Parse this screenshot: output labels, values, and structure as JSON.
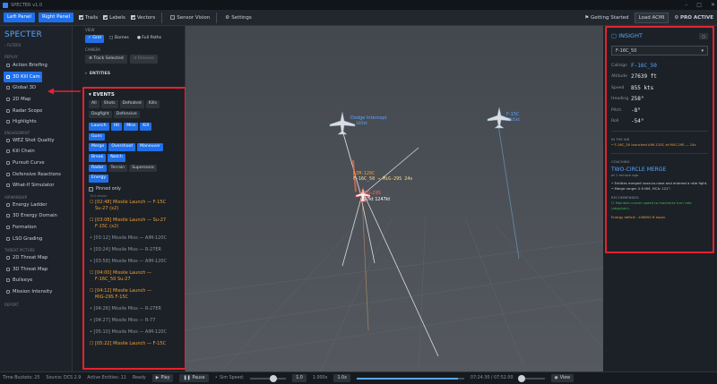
{
  "titlebar": {
    "title": "SPECTER v1.0"
  },
  "toolbar": {
    "left_panel": "Left Panel",
    "right_panel": "Right Panel",
    "trails": "Trails",
    "labels": "Labels",
    "vectors": "Vectors",
    "sensor_vision": "Sensor Vision",
    "settings": "Settings",
    "getting_started": "Getting Started",
    "load_acmi": "Load ACMI",
    "pro_active": "PRO ACTIVE"
  },
  "sidebar": {
    "brand": "SPECTER",
    "filters": "FILTERS",
    "replay_label": "REPLAY",
    "replay": [
      "Action Briefing",
      "3D Kill Cam",
      "Global 3D",
      "2D Map",
      "Radar Scope",
      "Highlights"
    ],
    "engagement_label": "ENGAGEMENT",
    "engagement": [
      "WEZ Shot Quality",
      "Kill Chain",
      "Pursuit Curve",
      "Defensive Reactions",
      "What-If Simulator"
    ],
    "airmanship_label": "AIRMANSHIP",
    "airmanship": [
      "Energy Ladder",
      "3D Energy Domain",
      "Formation",
      "LSO Grading"
    ],
    "threat_label": "THREAT PICTURE",
    "threat": [
      "2D Threat Map",
      "3D Threat Map",
      "Bullseye",
      "Mission Intensity"
    ],
    "report_label": "REPORT"
  },
  "panel": {
    "view_label": "VIEW",
    "grid": "Grid",
    "domes": "Domes",
    "full_paths": "Full Paths",
    "camera_label": "CAMERA",
    "track_selected": "Track Selected",
    "release": "Release",
    "entities": "ENTITIES",
    "events": "EVENTS",
    "chips_row1": [
      "All",
      "Shots",
      "Defeated",
      "Kills"
    ],
    "chips_row2": [
      "Dogfight",
      "Defensive"
    ],
    "chips_row3": [
      "Launch",
      "Hit",
      "Miss",
      "Kill"
    ],
    "chips_row4": [
      "Guns"
    ],
    "chips_row5": [
      "Merge",
      "Overshoot",
      "Maneuver"
    ],
    "chips_row6": [
      "Break",
      "Notch"
    ],
    "chips_row7": [
      "Radar",
      "Terrain",
      "Supersonic"
    ],
    "chips_row8": [
      "Energy"
    ],
    "pinned": "Pinned only",
    "shown": "154 shown",
    "events_list": [
      {
        "t": "[02:48] Missile Launch — F-15C",
        "t2": "Su-27 (x2)",
        "kind": "launch"
      },
      {
        "t": "[03:08] Missile Launch — Su-27",
        "t2": "F-15C (x2)",
        "kind": "launch"
      },
      {
        "t": "[03:12] Missile Miss — AIM-120C",
        "t2": "",
        "kind": "miss"
      },
      {
        "t": "[03:24] Missile Miss — R-27ER",
        "t2": "",
        "kind": "miss"
      },
      {
        "t": "[03:58] Missile Miss — AIM-120C",
        "t2": "",
        "kind": "miss"
      },
      {
        "t": "[04:00] Missile Launch —",
        "t2": "F-16C_50 Su-27",
        "kind": "launch"
      },
      {
        "t": "[04:12] Missile Launch —",
        "t2": "MiG-29S F-15C",
        "kind": "launch"
      },
      {
        "t": "[04:26] Missile Miss — R-27ER",
        "t2": "",
        "kind": "miss"
      },
      {
        "t": "[04:27] Missile Miss — R-77",
        "t2": "",
        "kind": "miss"
      },
      {
        "t": "[05:10] Missile Miss — AIM-120C",
        "t2": "",
        "kind": "miss"
      },
      {
        "t": "[05:22] Missile Launch — F-15C",
        "t2": "",
        "kind": "launch"
      }
    ]
  },
  "viewport": {
    "label_a": "Dodge Intercept",
    "label_a2": "305kt",
    "label_b": "F-15C",
    "label_b2": "305kt",
    "aim_label": "AIM-120C",
    "f16_label": "F-16C_50 → MiG-29S  24s",
    "mig_label": "MiG-29S",
    "mig_speed": "247kt   1247kt"
  },
  "insight": {
    "title": "INSIGHT",
    "select": "F-16C_50",
    "callsign_k": "Callsign",
    "callsign_v": "F-16C_50",
    "altitude_k": "Altitude",
    "altitude_v": "27639 ft",
    "speed_k": "Speed",
    "speed_v": "855 kts",
    "heading_k": "Heading",
    "heading_v": "258°",
    "pitch_k": "Pitch",
    "pitch_v": "-8°",
    "roll_k": "Roll",
    "roll_v": "-54°",
    "inair_label": "IN THE AIR",
    "inair_text": "• F-16C_50 launched AIM-120C at MiG-29S — 24s",
    "coach_label": "COACHING",
    "coach_title": "TWO-CIRCLE MERGE",
    "coach_sub": "at 1 minute ago",
    "coach_b1": "• Entities merged nose-to-nose and entered a rate fight.",
    "coach_b2": "• Merge range: 0.9 NM, HCA: 121°.",
    "rec_label": "RECOMMENDED",
    "rec_text": "Maintain corner speed to maximize turn rate (degs/sec).",
    "energy_text": "Energy deficit: -106650 ft equiv"
  },
  "status": {
    "buckets": "Time Buckets: 25",
    "source": "Source: DCS 2.9",
    "entities": "Active Entities: 11",
    "ready": "Ready",
    "play": "Play",
    "pause": "Pause",
    "sim_speed": "Sim Speed:",
    "speed_val": "1.000x",
    "btn_1": "1.0",
    "btn_10": "1.0x",
    "time": "07:24.30 / 07:52.00",
    "view": "View"
  }
}
